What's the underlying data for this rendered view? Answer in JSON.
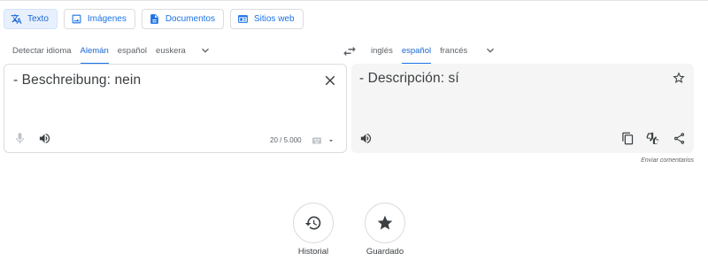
{
  "mode_tabs": [
    {
      "label": "Texto",
      "icon": "translate-icon",
      "active": true
    },
    {
      "label": "Imágenes",
      "icon": "image-icon",
      "active": false
    },
    {
      "label": "Documentos",
      "icon": "document-icon",
      "active": false
    },
    {
      "label": "Sitios web",
      "icon": "website-icon",
      "active": false
    }
  ],
  "source_langs": [
    "Detectar idioma",
    "Alemán",
    "español",
    "euskera"
  ],
  "source_active": "Alemán",
  "target_langs": [
    "inglés",
    "español",
    "francés"
  ],
  "target_active": "español",
  "source_panel": {
    "text": "- Beschreibung: nein",
    "char_count": "20 / 5.000"
  },
  "target_panel": {
    "text": "- Descripción: sí"
  },
  "feedback": "Enviar comentarios",
  "bottom": {
    "history_label": "Historial",
    "saved_label": "Guardado"
  },
  "colors": {
    "accent": "#1a73e8",
    "active_tab_bg": "#e8f0fe",
    "target_panel_bg": "#f5f5f5"
  }
}
